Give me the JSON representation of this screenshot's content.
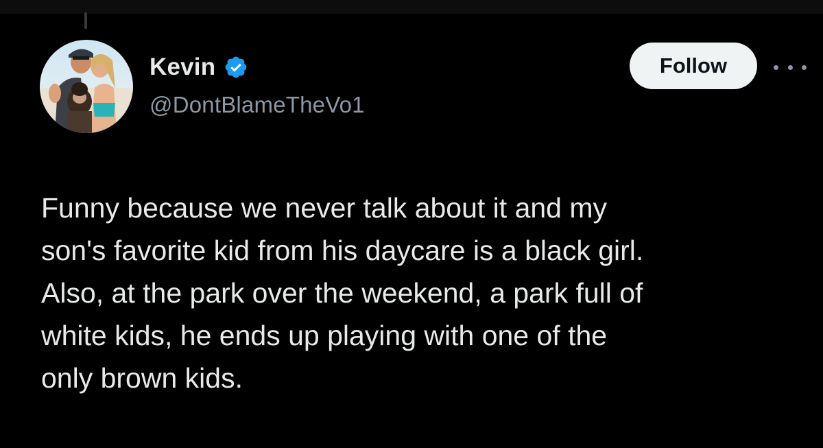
{
  "author": {
    "display_name": "Kevin",
    "handle": "@DontBlameTheVo1",
    "verified": true,
    "verified_icon": "verified-badge-icon",
    "avatar_icon": "profile-photo"
  },
  "actions": {
    "follow_label": "Follow",
    "more_icon": "more-options-icon"
  },
  "tweet": {
    "lines": [
      "Funny because we never talk about it and my",
      "son's favorite kid from his daycare is a black girl.",
      "Also, at the park over the weekend, a park full of",
      "white kids, he ends up playing with one of the",
      "only brown kids."
    ]
  },
  "colors": {
    "background": "#000000",
    "primary_text": "#e7e9ea",
    "secondary_text": "#8b98a5",
    "verified_blue": "#1d9bf0",
    "follow_button_bg": "#eff3f4",
    "follow_button_text": "#0f1419"
  }
}
